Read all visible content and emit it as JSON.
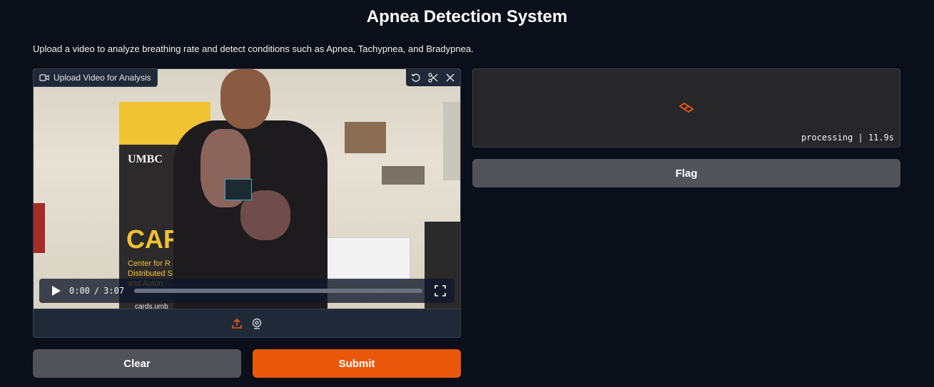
{
  "app": {
    "title": "Apnea Detection System",
    "description": "Upload a video to analyze breathing rate and detect conditions such as Apnea, Tachypnea, and Bradypnea."
  },
  "video_input": {
    "label": "Upload Video for Analysis",
    "label_icon": "video-camera-icon",
    "tools": [
      "undo-icon",
      "scissors-icon",
      "close-icon"
    ],
    "player": {
      "current_time": "0:00",
      "separator": "/",
      "duration": "3:07",
      "progress_fraction": 0
    },
    "sources": [
      "upload-icon",
      "webcam-icon"
    ]
  },
  "output": {
    "status_text": "processing | 11.9s",
    "loader_icon": "loading-spinner-icon"
  },
  "buttons": {
    "clear": "Clear",
    "submit": "Submit",
    "flag": "Flag"
  },
  "colors": {
    "accent": "#ea580c",
    "secondary_button": "#52525b",
    "background": "#0b0f19"
  }
}
